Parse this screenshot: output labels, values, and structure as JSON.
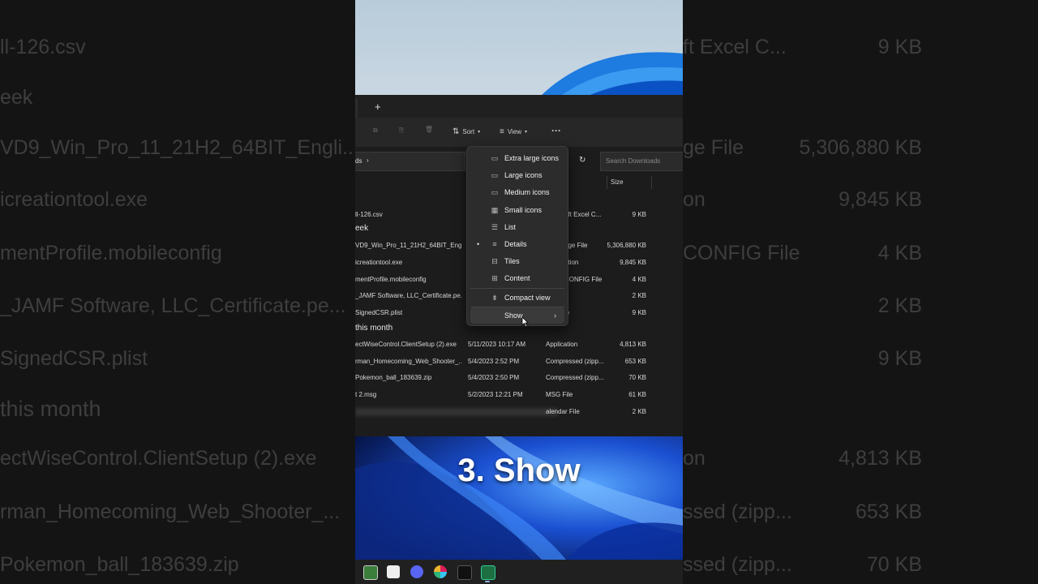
{
  "background_rows": {
    "left": [
      "ll-126.csv",
      "eek",
      "VD9_Win_Pro_11_21H2_64BIT_Engli...",
      "icreationtool.exe",
      "mentProfile.mobileconfig",
      "_JAMF Software, LLC_Certificate.pe...",
      "SignedCSR.plist",
      "this month",
      "ectWiseControl.ClientSetup (2).exe",
      "rman_Homecoming_Web_Shooter_...",
      "Pokemon_ball_183639.zip"
    ],
    "right_type": [
      "ft Excel C...",
      "",
      "ge File",
      "on",
      "CONFIG File",
      "",
      "",
      "",
      "on",
      "ssed (zipp...",
      "ssed (zipp..."
    ],
    "right_size": [
      "9 KB",
      "",
      "5,306,880 KB",
      "9,845 KB",
      "4 KB",
      "2 KB",
      "9 KB",
      "",
      "4,813 KB",
      "653 KB",
      "70 KB"
    ]
  },
  "explorer": {
    "new_tab": "+",
    "toolbar": {
      "sort_label": "Sort",
      "view_label": "View",
      "more": "···"
    },
    "address": {
      "crumb": "ds",
      "search_placeholder": "Search Downloads"
    },
    "column_size": "Size",
    "groups": {
      "week": "eek",
      "month": "this month"
    },
    "rows": [
      {
        "name": "ll-126.csv",
        "date": "",
        "type": "oft Excel C...",
        "size": "9 KB"
      },
      {
        "name": "VD9_Win_Pro_11_21H2_64BIT_Engli...",
        "date": "",
        "type": "age File",
        "size": "5,306,880 KB"
      },
      {
        "name": "icreationtool.exe",
        "date": "",
        "type": "ation",
        "size": "9,845 KB"
      },
      {
        "name": "mentProfile.mobileconfig",
        "date": "",
        "type": "CONFIG File",
        "size": "4 KB"
      },
      {
        "name": "_JAMF Software, LLC_Certificate.pe...",
        "date": "",
        "type": "e",
        "size": "2 KB"
      },
      {
        "name": "SignedCSR.plist",
        "date": "",
        "type": "le",
        "size": "9 KB"
      },
      {
        "name": "ectWiseControl.ClientSetup (2).exe",
        "date": "5/11/2023 10:17 AM",
        "type": "Application",
        "size": "4,813 KB"
      },
      {
        "name": "rman_Homecoming_Web_Shooter_...",
        "date": "5/4/2023 2:52 PM",
        "type": "Compressed (zipp...",
        "size": "653 KB"
      },
      {
        "name": "Pokemon_ball_183639.zip",
        "date": "5/4/2023 2:50 PM",
        "type": "Compressed (zipp...",
        "size": "70 KB"
      },
      {
        "name": "t 2.msg",
        "date": "5/2/2023 12:21 PM",
        "type": "MSG File",
        "size": "61 KB"
      },
      {
        "name": "",
        "date": "",
        "type": "alendar File",
        "size": "2 KB"
      }
    ]
  },
  "view_menu": {
    "items": [
      {
        "label": "Extra large icons",
        "icon": "monitor-icon"
      },
      {
        "label": "Large icons",
        "icon": "monitor-icon"
      },
      {
        "label": "Medium icons",
        "icon": "monitor-icon"
      },
      {
        "label": "Small icons",
        "icon": "grid-icon"
      },
      {
        "label": "List",
        "icon": "list-icon"
      },
      {
        "label": "Details",
        "icon": "details-icon",
        "selected": true
      },
      {
        "label": "Tiles",
        "icon": "tiles-icon"
      },
      {
        "label": "Content",
        "icon": "content-icon"
      },
      {
        "label": "Compact view",
        "icon": "compact-icon"
      },
      {
        "label": "Show",
        "icon": "",
        "submenu": true,
        "highlighted": true
      }
    ],
    "submenu_chevron": "›",
    "selected_bullet": "•"
  },
  "caption": "3. Show",
  "colors": {
    "accent": "#0a5fd8",
    "menu_bg": "#2c2c2c",
    "explorer_bg": "#1c1c1c"
  }
}
